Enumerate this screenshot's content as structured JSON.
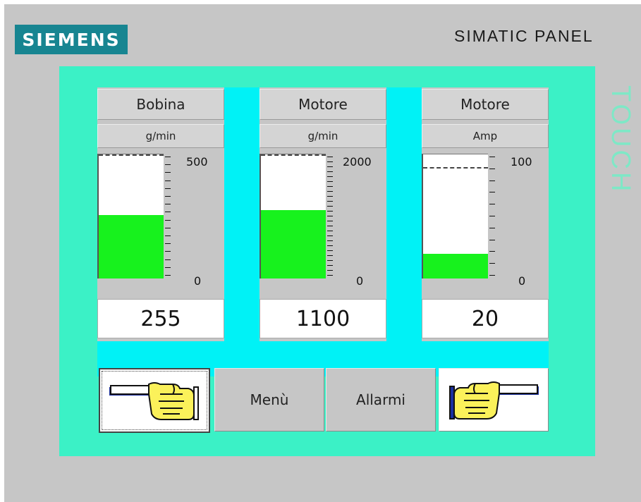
{
  "brand": "SIEMENS",
  "model": "SIMATIC PANEL",
  "side_label": "TOUCH",
  "colors": {
    "screen_bg": "#3bf1c6",
    "band_bg": "#00f2f6",
    "bar_fill": "#17f21d",
    "logo_bg": "#178591"
  },
  "gauges": [
    {
      "title": "Bobina",
      "unit": "g/min",
      "max_label": "500",
      "min_label": "0",
      "value_text": "255",
      "level": 0.51,
      "limit": 1.0
    },
    {
      "title": "Motore",
      "unit": "g/min",
      "max_label": "2000",
      "min_label": "0",
      "value_text": "1100",
      "level": 0.55,
      "limit": 1.0
    },
    {
      "title": "Motore",
      "unit": "Amp",
      "max_label": "100",
      "min_label": "0",
      "value_text": "20",
      "level": 0.2,
      "limit": 0.9
    }
  ],
  "footer": {
    "back_icon": "hand-pointing-left-icon",
    "menu_label": "Menù",
    "alarms_label": "Allarmi",
    "forward_icon": "hand-pointing-right-icon"
  }
}
